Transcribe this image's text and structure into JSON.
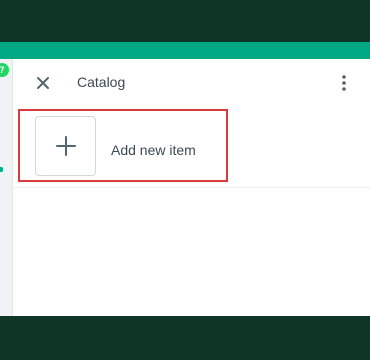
{
  "header": {
    "title": "Catalog",
    "close_icon": "close-icon",
    "menu_icon": "kebab-menu-icon"
  },
  "catalog": {
    "add_item_label": "Add new item",
    "add_icon": "plus-icon"
  },
  "sidebar": {
    "badge_count": "7"
  },
  "colors": {
    "accent": "#00a884",
    "dark": "#0f3527",
    "highlight": "#d93a3a",
    "badge": "#25d366"
  }
}
